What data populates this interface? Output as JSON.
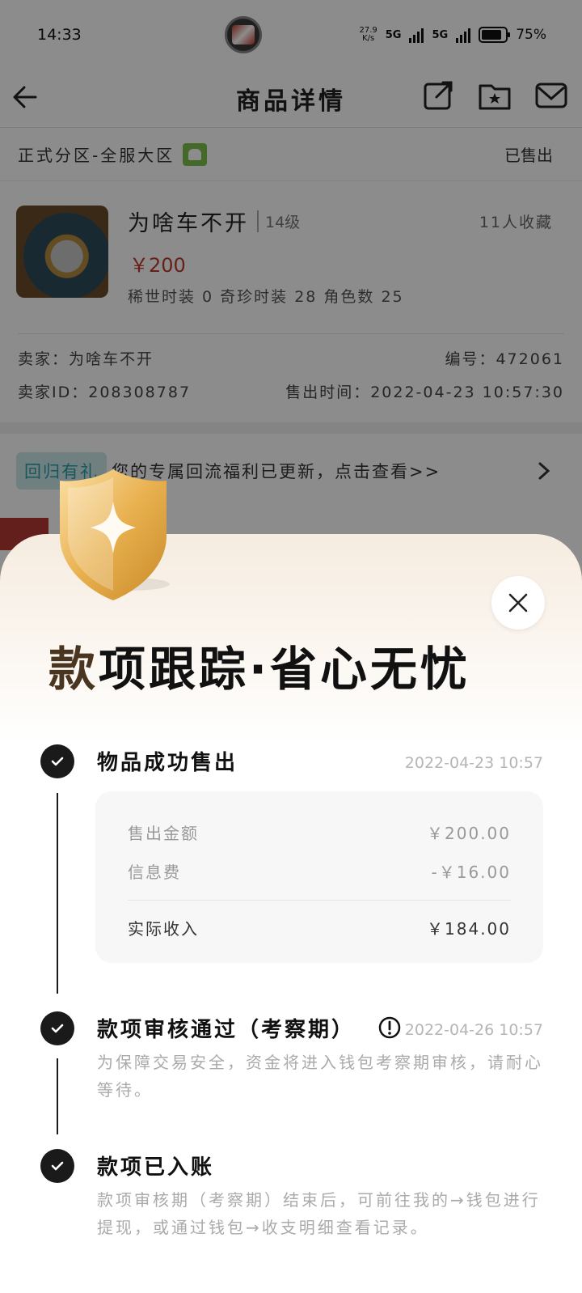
{
  "status_bar": {
    "time": "14:33",
    "net_speed_top": "27.9",
    "net_speed_bottom": "K/s",
    "signal_1": "5G",
    "signal_2": "5G",
    "battery": "75%"
  },
  "nav": {
    "title": "商品详情"
  },
  "zone": {
    "label": "正式分区-全服大区",
    "status": "已售出"
  },
  "product": {
    "name": "为啥车不开",
    "level": "14级",
    "favorites": "11人收藏",
    "price": "￥200",
    "desc": "稀世时装 0 奇珍时装 28 角色数 25"
  },
  "seller": {
    "name": "卖家：为啥车不开",
    "number": "编号：472061",
    "id": "卖家ID：208308787",
    "sold_time": "售出时间：2022-04-23 10:57:30"
  },
  "promo": {
    "tag": "回归有礼",
    "text": "您的专属回流福利已更新，点击查看>>"
  },
  "sheet": {
    "title_first": "款",
    "title_rest": "项跟踪·省心无忧",
    "steps": [
      {
        "title": "物品成功售出",
        "time": "2022-04-23 10:57"
      },
      {
        "title": "款项审核通过（考察期）",
        "time": "2022-04-26 10:57",
        "desc": "为保障交易安全，资金将进入钱包考察期审核，请耐心等待。"
      },
      {
        "title": "款项已入账",
        "desc": "款项审核期（考察期）结束后，可前往我的→钱包进行提现，或通过钱包→收支明细查看记录。"
      }
    ],
    "amounts": {
      "sale_label": "售出金额",
      "sale_value": "￥200.00",
      "fee_label": "信息费",
      "fee_value": "-￥16.00",
      "net_label": "实际收入",
      "net_value": "￥184.00"
    }
  },
  "colors": {
    "price_red": "#c0392b",
    "promo_tag_bg": "#cde8ea",
    "promo_tag_fg": "#2aa1a8",
    "shield_gold": "#e8b04e"
  },
  "icons": [
    "back-arrow-icon",
    "share-icon",
    "favorite-folder-icon",
    "mail-icon",
    "android-icon",
    "chevron-right-icon",
    "shield-star-icon",
    "close-icon",
    "check-icon",
    "warning-circle-icon"
  ]
}
